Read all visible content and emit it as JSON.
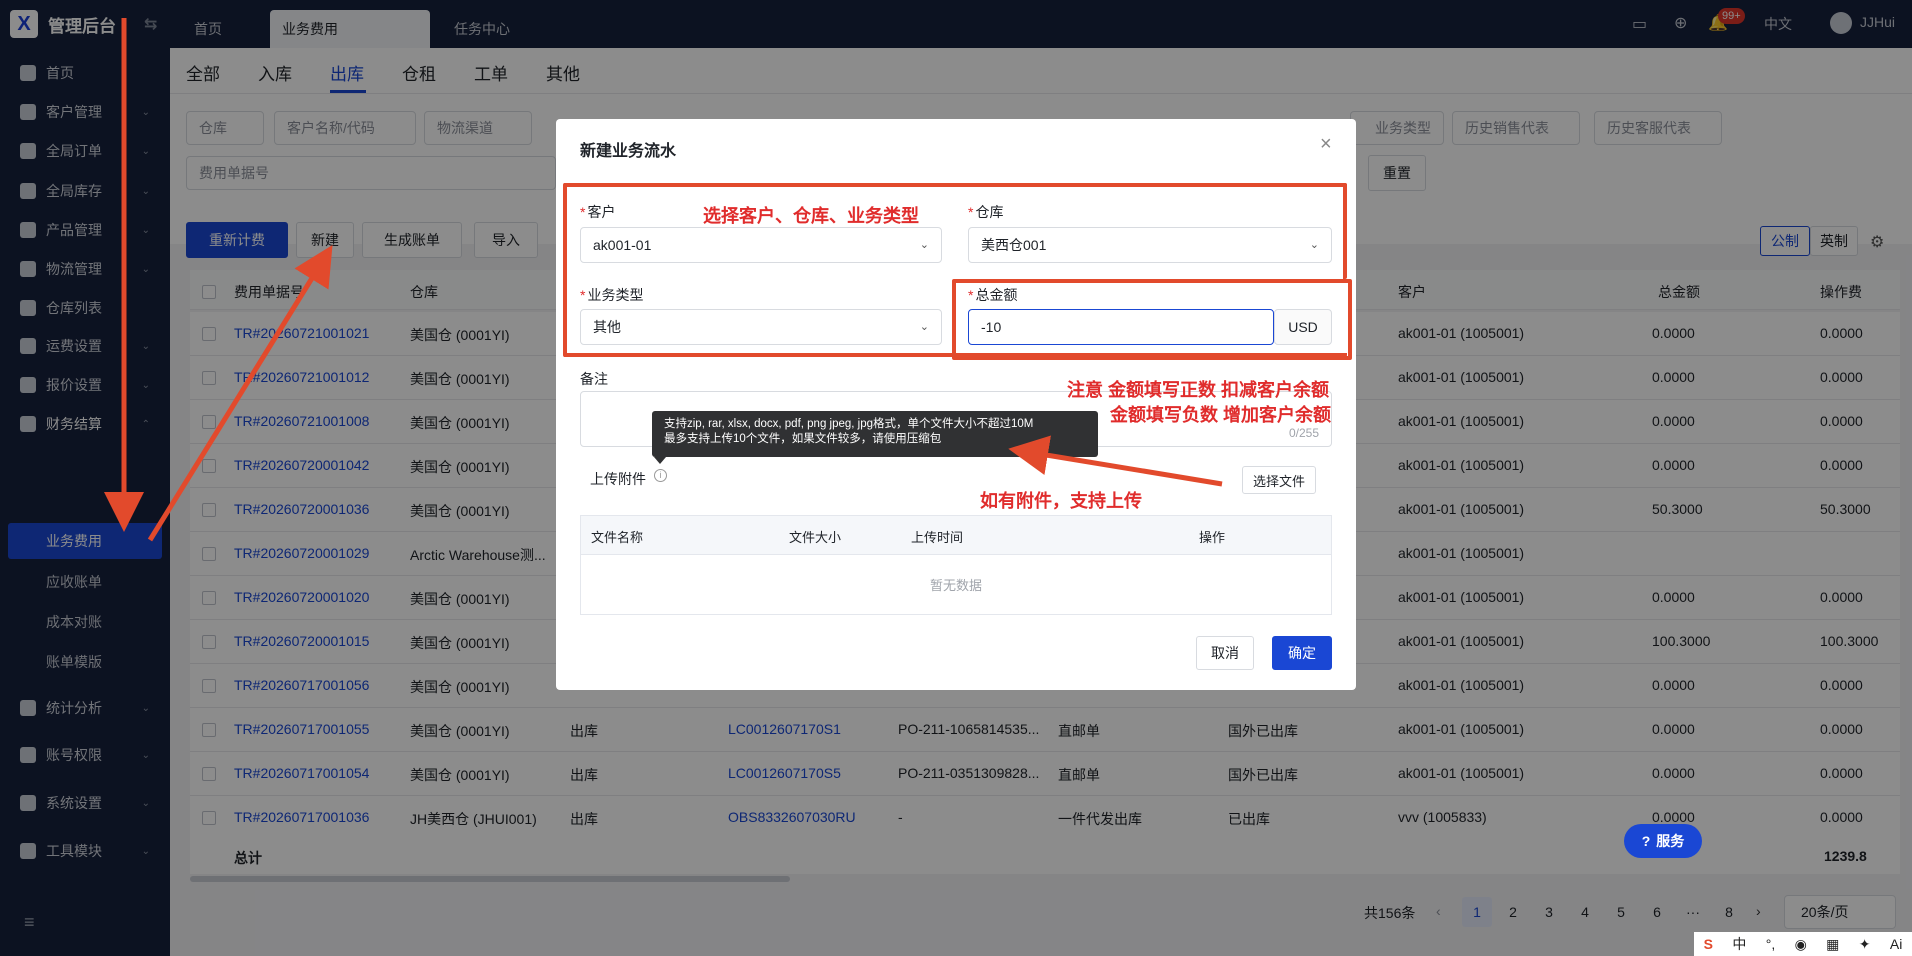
{
  "app": {
    "title": "管理后台",
    "logo_letter": "X"
  },
  "topbar": {
    "tabs": [
      {
        "label": "首页"
      },
      {
        "label": "业务费用"
      },
      {
        "label": "任务中心"
      }
    ],
    "badge": "99+",
    "lang": "中文",
    "user": "JJHui"
  },
  "sidebar": {
    "items": [
      {
        "label": "首页"
      },
      {
        "label": "客户管理"
      },
      {
        "label": "全局订单"
      },
      {
        "label": "全局库存"
      },
      {
        "label": "产品管理"
      },
      {
        "label": "物流管理"
      },
      {
        "label": "仓库列表"
      },
      {
        "label": "运费设置"
      },
      {
        "label": "报价设置"
      },
      {
        "label": "财务结算"
      },
      {
        "label": "统计分析"
      },
      {
        "label": "账号权限"
      },
      {
        "label": "系统设置"
      },
      {
        "label": "工具模块"
      }
    ],
    "sub_items": [
      {
        "label": "业务费用"
      },
      {
        "label": "应收账单"
      },
      {
        "label": "成本对账"
      },
      {
        "label": "账单模版"
      }
    ]
  },
  "subtabs": [
    {
      "label": "全部"
    },
    {
      "label": "入库"
    },
    {
      "label": "出库"
    },
    {
      "label": "仓租"
    },
    {
      "label": "工单"
    },
    {
      "label": "其他"
    }
  ],
  "filters": {
    "warehouse": "仓库",
    "customer": "客户名称/代码",
    "channel": "物流渠道",
    "biz_type": "业务类型",
    "sales_rep": "历史销售代表",
    "cs_rep": "历史客服代表",
    "bill_no": "费用单据号",
    "reset": "重置"
  },
  "toolbar": {
    "recalc": "重新计费",
    "new": "新建",
    "gen_bill": "生成账单",
    "import": "导入",
    "metric": "公制",
    "imperial": "英制"
  },
  "table": {
    "headers": {
      "no": "费用单据号",
      "warehouse": "仓库",
      "customer": "客户",
      "total": "总金额",
      "op_fee": "操作费"
    },
    "rows": [
      {
        "no": "TR#20260721001021",
        "warehouse": "美国仓 (0001YI)",
        "type": "",
        "ref": "",
        "po": "",
        "mode": "",
        "status": "",
        "customer": "ak001-01 (1005001)",
        "total": "0.0000",
        "op_fee": "0.0000"
      },
      {
        "no": "TR#20260721001012",
        "warehouse": "美国仓 (0001YI)",
        "type": "",
        "ref": "",
        "po": "",
        "mode": "",
        "status": "",
        "customer": "ak001-01 (1005001)",
        "total": "0.0000",
        "op_fee": "0.0000"
      },
      {
        "no": "TR#20260721001008",
        "warehouse": "美国仓 (0001YI)",
        "type": "",
        "ref": "",
        "po": "",
        "mode": "",
        "status": "",
        "customer": "ak001-01 (1005001)",
        "total": "0.0000",
        "op_fee": "0.0000"
      },
      {
        "no": "TR#20260720001042",
        "warehouse": "美国仓 (0001YI)",
        "type": "",
        "ref": "",
        "po": "",
        "mode": "",
        "status": "",
        "customer": "ak001-01 (1005001)",
        "total": "0.0000",
        "op_fee": "0.0000"
      },
      {
        "no": "TR#20260720001036",
        "warehouse": "美国仓 (0001YI)",
        "type": "",
        "ref": "",
        "po": "",
        "mode": "",
        "status": "",
        "customer": "ak001-01 (1005001)",
        "total": "50.3000",
        "op_fee": "50.3000"
      },
      {
        "no": "TR#20260720001029",
        "warehouse": "Arctic Warehouse测...",
        "type": "",
        "ref": "",
        "po": "",
        "mode": "",
        "status": "",
        "customer": "ak001-01 (1005001)",
        "total": "",
        "op_fee": ""
      },
      {
        "no": "TR#20260720001020",
        "warehouse": "美国仓 (0001YI)",
        "type": "",
        "ref": "",
        "po": "",
        "mode": "",
        "status": "",
        "customer": "ak001-01 (1005001)",
        "total": "0.0000",
        "op_fee": "0.0000"
      },
      {
        "no": "TR#20260720001015",
        "warehouse": "美国仓 (0001YI)",
        "type": "",
        "ref": "",
        "po": "",
        "mode": "",
        "status": "",
        "customer": "ak001-01 (1005001)",
        "total": "100.3000",
        "op_fee": "100.3000"
      },
      {
        "no": "TR#20260717001056",
        "warehouse": "美国仓 (0001YI)",
        "type": "",
        "ref": "",
        "po": "",
        "mode": "",
        "status": "",
        "customer": "ak001-01 (1005001)",
        "total": "0.0000",
        "op_fee": "0.0000"
      },
      {
        "no": "TR#20260717001055",
        "warehouse": "美国仓 (0001YI)",
        "type": "出库",
        "ref": "LC0012607170S1",
        "po": "PO-211-1065814535...",
        "mode": "直邮单",
        "status": "国外已出库",
        "customer": "ak001-01 (1005001)",
        "total": "0.0000",
        "op_fee": "0.0000"
      },
      {
        "no": "TR#20260717001054",
        "warehouse": "美国仓 (0001YI)",
        "type": "出库",
        "ref": "LC0012607170S5",
        "po": "PO-211-0351309828...",
        "mode": "直邮单",
        "status": "国外已出库",
        "customer": "ak001-01 (1005001)",
        "total": "0.0000",
        "op_fee": "0.0000"
      },
      {
        "no": "TR#20260717001036",
        "warehouse": "JH美西仓 (JHUI001)",
        "type": "出库",
        "ref": "OBS8332607030RU",
        "po": "-",
        "mode": "一件代发出库",
        "status": "已出库",
        "customer": "vvv (1005833)",
        "total": "0.0000",
        "op_fee": "0.0000"
      }
    ],
    "footer": {
      "label": "总计",
      "total": "1239.8"
    }
  },
  "pagination": {
    "total": "共156条",
    "pages": [
      "1",
      "2",
      "3",
      "4",
      "5",
      "6",
      "···",
      "8"
    ],
    "size": "20条/页"
  },
  "service": "服务",
  "modal": {
    "title": "新建业务流水",
    "customer_label": "客户",
    "customer_value": "ak001-01",
    "warehouse_label": "仓库",
    "warehouse_value": "美西仓001",
    "type_label": "业务类型",
    "type_value": "其他",
    "amount_label": "总金额",
    "amount_value": "-10",
    "currency": "USD",
    "remark_label": "备注",
    "remark_count": "0/255",
    "upload_label": "上传附件",
    "choose_file": "选择文件",
    "tooltip_line1": "支持zip, rar, xlsx, docx, pdf, png jpeg, jpg格式，单个文件大小不超过10M",
    "tooltip_line2": "最多支持上传10个文件，如果文件较多，请使用压缩包",
    "file_headers": [
      "文件名称",
      "文件大小",
      "上传时间",
      "操作"
    ],
    "empty": "暂无数据",
    "cancel": "取消",
    "confirm": "确定"
  },
  "annotations": {
    "select": "选择客户、仓库、业务类型",
    "note1": "注意 金额填写正数   扣减客户余额",
    "note2": "金额填写负数   增加客户余额",
    "upload": "如有附件，支持上传"
  },
  "colors": {
    "primary": "#1a47d4",
    "sidebar": "#16213d",
    "annotation": "#e24a2c"
  }
}
